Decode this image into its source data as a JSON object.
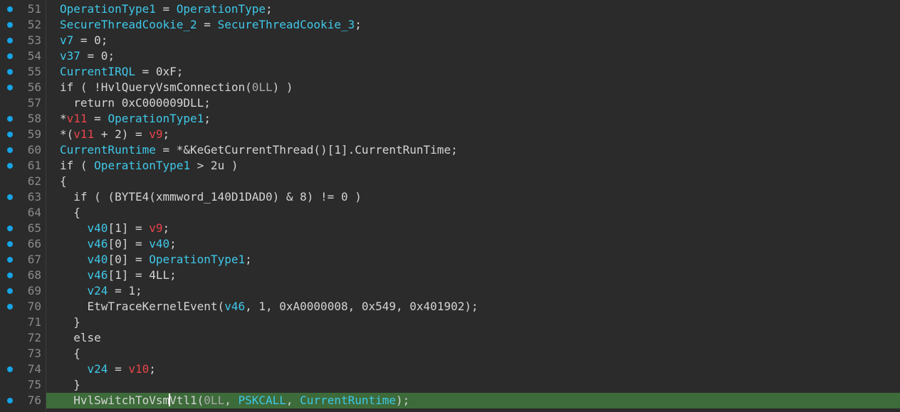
{
  "colors": {
    "background": "#2b2b2b",
    "identifier": "#3fc8e8",
    "local_variable": "#e8444a",
    "plain": "#d4d4d4",
    "number": "#b9b9b9",
    "line_number": "#8a8a8a",
    "breakpoint": "#16a4e6",
    "current_line": "#3d6b3a"
  },
  "current_line": 76,
  "lines": [
    {
      "n": "51",
      "bp": true,
      "tokens": [
        [
          "c",
          "OperationType1"
        ],
        [
          "p",
          " = "
        ],
        [
          "c",
          "OperationType"
        ],
        [
          "p",
          ";"
        ]
      ]
    },
    {
      "n": "52",
      "bp": true,
      "tokens": [
        [
          "c",
          "SecureThreadCookie_2"
        ],
        [
          "p",
          " = "
        ],
        [
          "c",
          "SecureThreadCookie_3"
        ],
        [
          "p",
          ";"
        ]
      ]
    },
    {
      "n": "53",
      "bp": true,
      "tokens": [
        [
          "c",
          "v7"
        ],
        [
          "p",
          " = 0;"
        ]
      ]
    },
    {
      "n": "54",
      "bp": true,
      "tokens": [
        [
          "c",
          "v37"
        ],
        [
          "p",
          " = 0;"
        ]
      ]
    },
    {
      "n": "55",
      "bp": true,
      "tokens": [
        [
          "c",
          "CurrentIRQL"
        ],
        [
          "p",
          " = 0xF;"
        ]
      ]
    },
    {
      "n": "56",
      "bp": true,
      "tokens": [
        [
          "p",
          "if ( !HvlQueryVsmConnection("
        ],
        [
          "d",
          "0LL"
        ],
        [
          "p",
          ") )"
        ]
      ]
    },
    {
      "n": "57",
      "bp": false,
      "tokens": [
        [
          "p",
          "  return 0xC000009DLL;"
        ]
      ]
    },
    {
      "n": "58",
      "bp": true,
      "tokens": [
        [
          "p",
          "*"
        ],
        [
          "r",
          "v11"
        ],
        [
          "p",
          " = "
        ],
        [
          "c",
          "OperationType1"
        ],
        [
          "p",
          ";"
        ]
      ]
    },
    {
      "n": "59",
      "bp": true,
      "tokens": [
        [
          "p",
          "*("
        ],
        [
          "r",
          "v11"
        ],
        [
          "p",
          " + 2) = "
        ],
        [
          "r",
          "v9"
        ],
        [
          "p",
          ";"
        ]
      ]
    },
    {
      "n": "60",
      "bp": true,
      "tokens": [
        [
          "c",
          "CurrentRuntime"
        ],
        [
          "p",
          " = *&KeGetCurrentThread()[1].CurrentRunTime;"
        ]
      ]
    },
    {
      "n": "61",
      "bp": true,
      "tokens": [
        [
          "p",
          "if ( "
        ],
        [
          "c",
          "OperationType1"
        ],
        [
          "p",
          " > 2u )"
        ]
      ]
    },
    {
      "n": "62",
      "bp": false,
      "tokens": [
        [
          "p",
          "{"
        ]
      ]
    },
    {
      "n": "63",
      "bp": true,
      "tokens": [
        [
          "p",
          "  if ( (BYTE4(xmmword_140D1DAD0) & 8) != 0 )"
        ]
      ]
    },
    {
      "n": "64",
      "bp": false,
      "tokens": [
        [
          "p",
          "  {"
        ]
      ]
    },
    {
      "n": "65",
      "bp": true,
      "tokens": [
        [
          "p",
          "    "
        ],
        [
          "c",
          "v40"
        ],
        [
          "p",
          "[1] = "
        ],
        [
          "r",
          "v9"
        ],
        [
          "p",
          ";"
        ]
      ]
    },
    {
      "n": "66",
      "bp": true,
      "tokens": [
        [
          "p",
          "    "
        ],
        [
          "c",
          "v46"
        ],
        [
          "p",
          "[0] = "
        ],
        [
          "c",
          "v40"
        ],
        [
          "p",
          ";"
        ]
      ]
    },
    {
      "n": "67",
      "bp": true,
      "tokens": [
        [
          "p",
          "    "
        ],
        [
          "c",
          "v40"
        ],
        [
          "p",
          "[0] = "
        ],
        [
          "c",
          "OperationType1"
        ],
        [
          "p",
          ";"
        ]
      ]
    },
    {
      "n": "68",
      "bp": true,
      "tokens": [
        [
          "p",
          "    "
        ],
        [
          "c",
          "v46"
        ],
        [
          "p",
          "[1] = 4LL;"
        ]
      ]
    },
    {
      "n": "69",
      "bp": true,
      "tokens": [
        [
          "p",
          "    "
        ],
        [
          "c",
          "v24"
        ],
        [
          "p",
          " = 1;"
        ]
      ]
    },
    {
      "n": "70",
      "bp": true,
      "tokens": [
        [
          "p",
          "    EtwTraceKernelEvent("
        ],
        [
          "c",
          "v46"
        ],
        [
          "p",
          ", 1, 0xA0000008, 0x549, 0x401902);"
        ]
      ]
    },
    {
      "n": "71",
      "bp": false,
      "tokens": [
        [
          "p",
          "  }"
        ]
      ]
    },
    {
      "n": "72",
      "bp": false,
      "tokens": [
        [
          "p",
          "  else"
        ]
      ]
    },
    {
      "n": "73",
      "bp": false,
      "tokens": [
        [
          "p",
          "  {"
        ]
      ]
    },
    {
      "n": "74",
      "bp": true,
      "tokens": [
        [
          "p",
          "    "
        ],
        [
          "c",
          "v24"
        ],
        [
          "p",
          " = "
        ],
        [
          "r",
          "v10"
        ],
        [
          "p",
          ";"
        ]
      ]
    },
    {
      "n": "75",
      "bp": false,
      "tokens": [
        [
          "p",
          "  }"
        ]
      ]
    },
    {
      "n": "76",
      "bp": true,
      "tokens": [
        [
          "p",
          "  HvlSwitchToVsm"
        ],
        [
          "caret",
          ""
        ],
        [
          "p",
          "Vtl1("
        ],
        [
          "d",
          "0LL"
        ],
        [
          "p",
          ", "
        ],
        [
          "c",
          "PSKCALL"
        ],
        [
          "p",
          ", "
        ],
        [
          "c",
          "CurrentRuntime"
        ],
        [
          "p",
          ");"
        ]
      ]
    }
  ]
}
